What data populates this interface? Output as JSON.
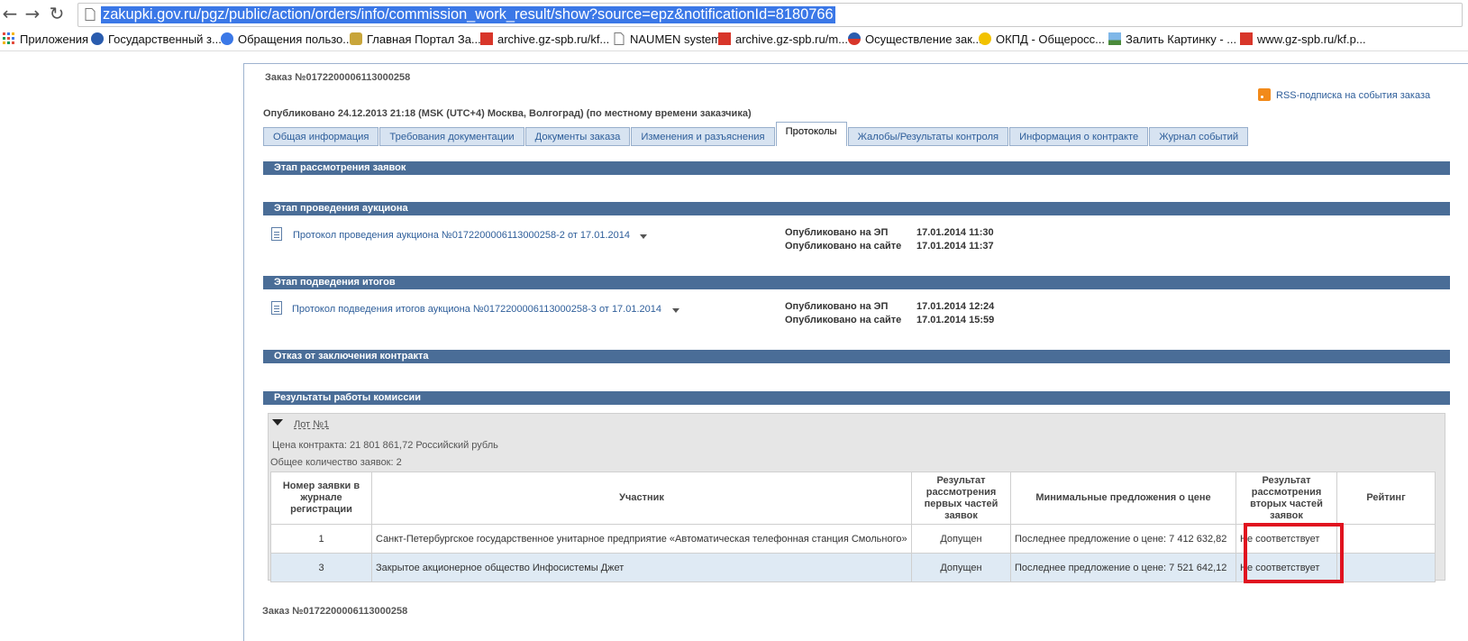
{
  "browser": {
    "url": "zakupki.gov.ru/pgz/public/action/orders/info/commission_work_result/show?source=epz&notificationId=8180766",
    "bookmarks": [
      {
        "label": "Приложения"
      },
      {
        "label": "Государственный з..."
      },
      {
        "label": "Обращения пользо..."
      },
      {
        "label": "Главная Портал За..."
      },
      {
        "label": "archive.gz-spb.ru/kf..."
      },
      {
        "label": "NAUMEN system"
      },
      {
        "label": "archive.gz-spb.ru/m..."
      },
      {
        "label": "Осуществление зак..."
      },
      {
        "label": "ОКПД - Общеросс..."
      },
      {
        "label": "Залить Картинку - ..."
      },
      {
        "label": "www.gz-spb.ru/kf.p..."
      }
    ]
  },
  "order": {
    "title": "Заказ №0172200006113000258",
    "published": "Опубликовано 24.12.2013 21:18 (MSK (UTC+4) Москва, Волгоград) (по местному времени заказчика)",
    "rss_label": "RSS-подписка на события заказа"
  },
  "tabs": [
    {
      "label": "Общая информация"
    },
    {
      "label": "Требования документации"
    },
    {
      "label": "Документы заказа"
    },
    {
      "label": "Изменения и разъяснения"
    },
    {
      "label": "Протоколы"
    },
    {
      "label": "Жалобы/Результаты контроля"
    },
    {
      "label": "Информация о контракте"
    },
    {
      "label": "Журнал событий"
    }
  ],
  "sections": {
    "review": "Этап рассмотрения заявок",
    "auction": "Этап проведения аукциона",
    "summary": "Этап подведения итогов",
    "refusal": "Отказ от заключения контракта",
    "commission": "Результаты работы комиссии"
  },
  "protocols": {
    "auction": {
      "link": "Протокол проведения аукциона №0172200006113000258-2 от 17.01.2014",
      "pub_ep_label": "Опубликовано на ЭП",
      "pub_ep_value": "17.01.2014 11:30",
      "pub_site_label": "Опубликовано на сайте",
      "pub_site_value": "17.01.2014 11:37"
    },
    "summary": {
      "link": "Протокол подведения итогов аукциона №0172200006113000258-3 от 17.01.2014",
      "pub_ep_label": "Опубликовано на ЭП",
      "pub_ep_value": "17.01.2014 12:24",
      "pub_site_label": "Опубликовано на сайте",
      "pub_site_value": "17.01.2014 15:59"
    }
  },
  "lot": {
    "label": "Лот №1",
    "price": "Цена контракта: 21 801 861,72  Российский рубль",
    "count": "Общее количество заявок: 2"
  },
  "table": {
    "headers": [
      "Номер заявки в журнале регистрации",
      "Участник",
      "Результат рассмотрения первых частей заявок",
      "Минимальные предложения о цене",
      "Результат рассмотрения вторых частей заявок",
      "Рейтинг"
    ],
    "rows": [
      {
        "num": "1",
        "participant": "Санкт-Петербургское государственное унитарное предприятие «Автоматическая телефонная станция Смольного»",
        "first": "Допущен",
        "price": "Последнее предложение о цене:  7 412 632,82",
        "second": "Не соответствует",
        "rating": ""
      },
      {
        "num": "3",
        "participant": "Закрытое акционерное общество Инфосистемы Джет",
        "first": "Допущен",
        "price": "Последнее предложение о цене:  7 521 642,12",
        "second": "Не соответствует",
        "rating": ""
      }
    ]
  },
  "footer": {
    "title": "Заказ №0172200006113000258"
  },
  "colors": {
    "section_bar": "#4a6d97",
    "tab_bg": "#d7e3f1",
    "link": "#2e5e9a",
    "highlight": "#e0131f",
    "url_select": "#3b78e7"
  }
}
